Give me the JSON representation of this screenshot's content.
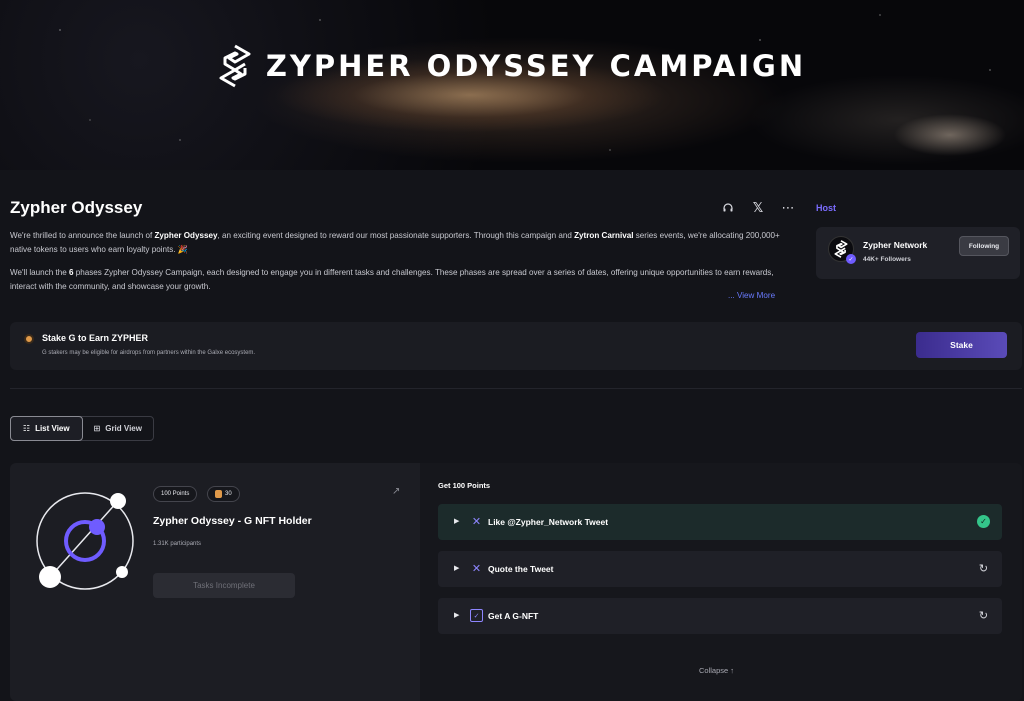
{
  "banner": {
    "title": "ZYPHER ODYSSEY CAMPAIGN",
    "logo_icon": "zypher-logo"
  },
  "campaign": {
    "title": "Zypher Odyssey",
    "actions": [
      "headset-icon",
      "x-icon",
      "more-icon"
    ],
    "desc_p1_a": "We're thrilled to announce the launch of ",
    "desc_p1_b": "Zypher Odyssey",
    "desc_p1_c": ", an exciting event designed to reward our most passionate supporters. Through this campaign and ",
    "desc_p1_d": "Zytron Carnival",
    "desc_p1_e": " series events, we're allocating 200,000+ native tokens to users who earn loyalty points. 🎉",
    "desc_p2_a": "We'll launch the ",
    "desc_p2_b": "6",
    "desc_p2_c": " phases Zypher Odyssey Campaign, each designed to engage you in different tasks and challenges. These phases are spread over a series of dates, offering unique opportunities to earn rewards, interact with the community, and showcase your growth.",
    "view_more": "... View More"
  },
  "host": {
    "label": "Host",
    "name": "Zypher Network",
    "followers": "44K+ Followers",
    "follow_button": "Following"
  },
  "stake": {
    "title": "Stake G to Earn ZYPHER",
    "subtitle": "G stakers may be eligible for airdrops from partners within the Galxe ecosystem.",
    "button": "Stake"
  },
  "view_toggle": {
    "list": "List View",
    "grid": "Grid View",
    "active": "list"
  },
  "quest": {
    "points_badge": "100 Points",
    "count_badge": "30",
    "name": "Zypher Odyssey - G NFT Holder",
    "participants": "1.31K participants",
    "cta": "Tasks Incomplete"
  },
  "tasks": {
    "header": "Get 100 Points",
    "items": [
      {
        "label": "Like @Zypher_Network Tweet",
        "icon": "x-icon",
        "status": "completed"
      },
      {
        "label": "Quote the Tweet",
        "icon": "x-icon",
        "status": "pending"
      },
      {
        "label": "Get A G-NFT",
        "icon": "nft-icon",
        "status": "pending"
      }
    ],
    "collapse": "Collapse"
  },
  "colors": {
    "accent": "#7b6cff",
    "success": "#34c58a",
    "background": "#131419"
  }
}
